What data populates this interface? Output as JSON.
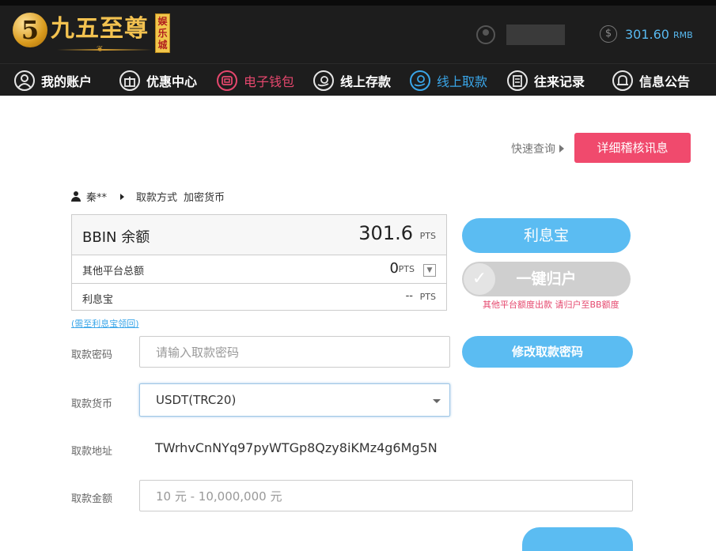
{
  "brand": {
    "logo_numeral": "5",
    "name": "九五至尊",
    "badge": "娱乐城",
    "ornament": "❦"
  },
  "account": {
    "balance": "301.60",
    "currency": "RMB",
    "coin_symbol": "$"
  },
  "nav": {
    "items": [
      {
        "label": "我的账户",
        "icon": "user-circle-icon"
      },
      {
        "label": "优惠中心",
        "icon": "gift-icon"
      },
      {
        "label": "电子钱包",
        "icon": "wallet-icon"
      },
      {
        "label": "线上存款",
        "icon": "deposit-icon"
      },
      {
        "label": "线上取款",
        "icon": "withdraw-icon"
      },
      {
        "label": "往来记录",
        "icon": "records-icon"
      },
      {
        "label": "信息公告",
        "icon": "bell-icon"
      }
    ],
    "active_color": "#3aa6e9",
    "highlight_color": "#e5476d"
  },
  "toolbar": {
    "quick_query": "快速查询",
    "detail_button": "详细稽核讯息"
  },
  "breadcrumb": {
    "user": "秦**",
    "method_label": "取款方式",
    "method_value": "加密货币"
  },
  "balances": {
    "bbin_label": "BBIN 余额",
    "bbin_value": "301.6",
    "others_label": "其他平台总额",
    "others_value": "0",
    "lixibao_label": "利息宝",
    "lixibao_value": "--",
    "unit": "PTS"
  },
  "actions": {
    "lixibao_button": "利息宝",
    "onekey_button": "一键归户",
    "onekey_note": "其他平台额度出款 请归户至BB额度",
    "recall_link": "(需至利息宝领回)",
    "change_password_button": "修改取款密码"
  },
  "form": {
    "password_label": "取款密码",
    "password_placeholder": "请输入取款密码",
    "currency_label": "取款货币",
    "currency_value": "USDT(TRC20)",
    "address_label": "取款地址",
    "address_value": "TWrhvCnNYq97pyWTGp8Qzy8iKMz4g6Mg5N",
    "amount_label": "取款金额",
    "amount_placeholder": "10 元 - 10,000,000 元"
  }
}
